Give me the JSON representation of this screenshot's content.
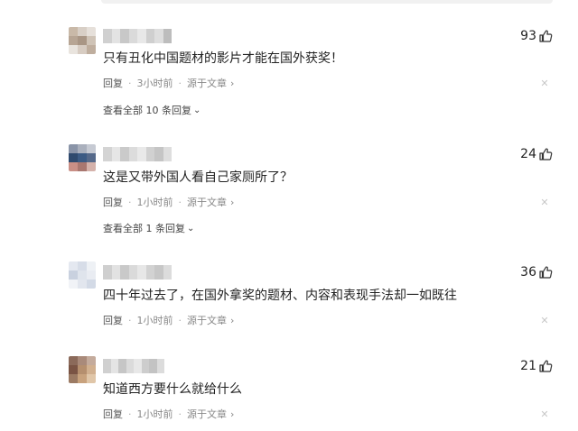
{
  "comments": [
    {
      "likes": "93",
      "text": "只有丑化中国题材的影片才能在国外获奖！",
      "reply_label": "回复",
      "time": "3小时前",
      "source_label": "源于文章",
      "more_replies": "查看全部 10 条回复",
      "avatar_colors": [
        "#c9b9a8",
        "#d8cfc6",
        "#e6e0da",
        "#b7a594",
        "#a99685",
        "#cfc3b6",
        "#e9e4de",
        "#d7ccc2",
        "#bfae9e"
      ],
      "name_blur": [
        "#d0d0d0",
        "#e3e3e3",
        "#c8c8c8",
        "#dadada",
        "#e8e8e8",
        "#cfcfcf",
        "#dedede",
        "#bdbdbd"
      ]
    },
    {
      "likes": "24",
      "text": "这是又带外国人看自己家厕所了？",
      "reply_label": "回复",
      "time": "1小时前",
      "source_label": "源于文章",
      "more_replies": "查看全部 1 条回复",
      "avatar_colors": [
        "#8a94a8",
        "#aab0bd",
        "#c6cad3",
        "#2f4a6e",
        "#3c5b84",
        "#55698a",
        "#c98f86",
        "#a97770",
        "#d5b2ab"
      ],
      "name_blur": [
        "#d4d4d4",
        "#e6e6e6",
        "#cacaca",
        "#dcdcdc",
        "#e9e9e9",
        "#d1d1d1",
        "#c5c5c5",
        "#dedede"
      ]
    },
    {
      "likes": "36",
      "text": "四十年过去了，在国外拿奖的题材、内容和表现手法却一如既往",
      "reply_label": "回复",
      "time": "1小时前",
      "source_label": "源于文章",
      "avatar_colors": [
        "#e4e8f0",
        "#d7dde8",
        "#eef1f5",
        "#c9d1df",
        "#dfe4ec",
        "#e9ecf2",
        "#f1f3f7",
        "#e2e6ee",
        "#d3dae6"
      ],
      "name_blur": [
        "#cfcfcf",
        "#e2e2e2",
        "#c9c9c9",
        "#dadada",
        "#e7e7e7",
        "#d2d2d2",
        "#c7c7c7",
        "#dcdcdc"
      ]
    },
    {
      "likes": "21",
      "text": "知道西方要什么就给什么",
      "reply_label": "回复",
      "time": "1小时前",
      "source_label": "源于文章",
      "avatar_colors": [
        "#8b6a5a",
        "#a98a7a",
        "#c4ab9c",
        "#7a5444",
        "#b58f6e",
        "#d1b08f",
        "#9b7a63",
        "#c8a27d",
        "#e0c6a8"
      ],
      "name_blur": [
        "#d0d0d0",
        "#e4e4e4",
        "#c6c6c6",
        "#dbdbdb",
        "#e8e8e8",
        "#cdcdcd",
        "#c3c3c3",
        "#dcdcdc"
      ]
    }
  ],
  "icons": {
    "like": "thumbs-up-icon",
    "close": "close-icon",
    "chevron": "chevron-right-icon",
    "more_chevron": "chevron-down-icon"
  }
}
